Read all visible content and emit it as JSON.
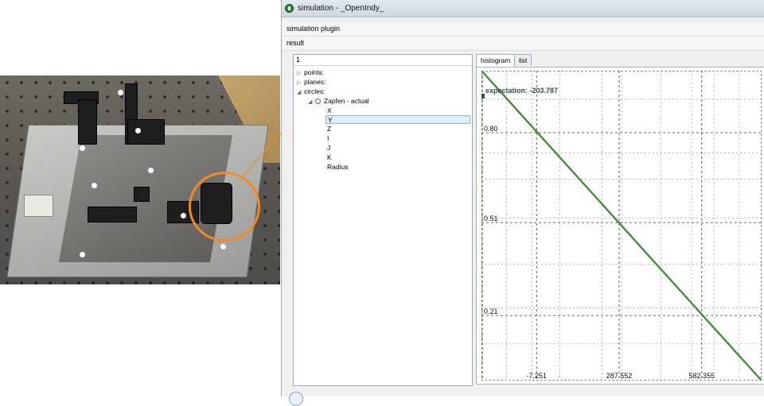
{
  "window": {
    "title": "simulation - _OpenIndy_",
    "menu_label": "simulation plugin",
    "result_label": "result"
  },
  "tree": {
    "header": "1",
    "items": [
      {
        "label": "points:",
        "expanded": false,
        "level": 0
      },
      {
        "label": "planes:",
        "expanded": false,
        "level": 0
      },
      {
        "label": "circles:",
        "expanded": true,
        "level": 0
      },
      {
        "label": "Zapfen - actual",
        "expanded": true,
        "level": 1
      },
      {
        "label": "X",
        "level": 2
      },
      {
        "label": "Y",
        "level": 2,
        "selected": true
      },
      {
        "label": "Z",
        "level": 2
      },
      {
        "label": "I",
        "level": 2
      },
      {
        "label": "J",
        "level": 2
      },
      {
        "label": "K",
        "level": 2
      },
      {
        "label": "Radius",
        "level": 2
      }
    ]
  },
  "tabs": [
    "histogram",
    "list"
  ],
  "active_tab": "histogram",
  "chart_data": {
    "type": "line",
    "x_ticks": [
      "-7.251",
      "287.552",
      "582.355"
    ],
    "y_ticks": [
      "0.80",
      "0.51",
      "0.21"
    ],
    "annotation": "expectation: -203.787",
    "expectation_x": -203.787,
    "series": [
      {
        "x": [
          -203.787,
          796.0
        ],
        "y": [
          1.0,
          0.0
        ]
      }
    ],
    "xlim": [
      -203.787,
      796.0
    ],
    "ylim": [
      0.0,
      1.0
    ],
    "grid": true,
    "line_color": "#4a8a3e",
    "grid_color": "#3a3a3a"
  },
  "colors": {
    "highlight_ring": "#f08a2a",
    "connector": "#f08a2a"
  }
}
